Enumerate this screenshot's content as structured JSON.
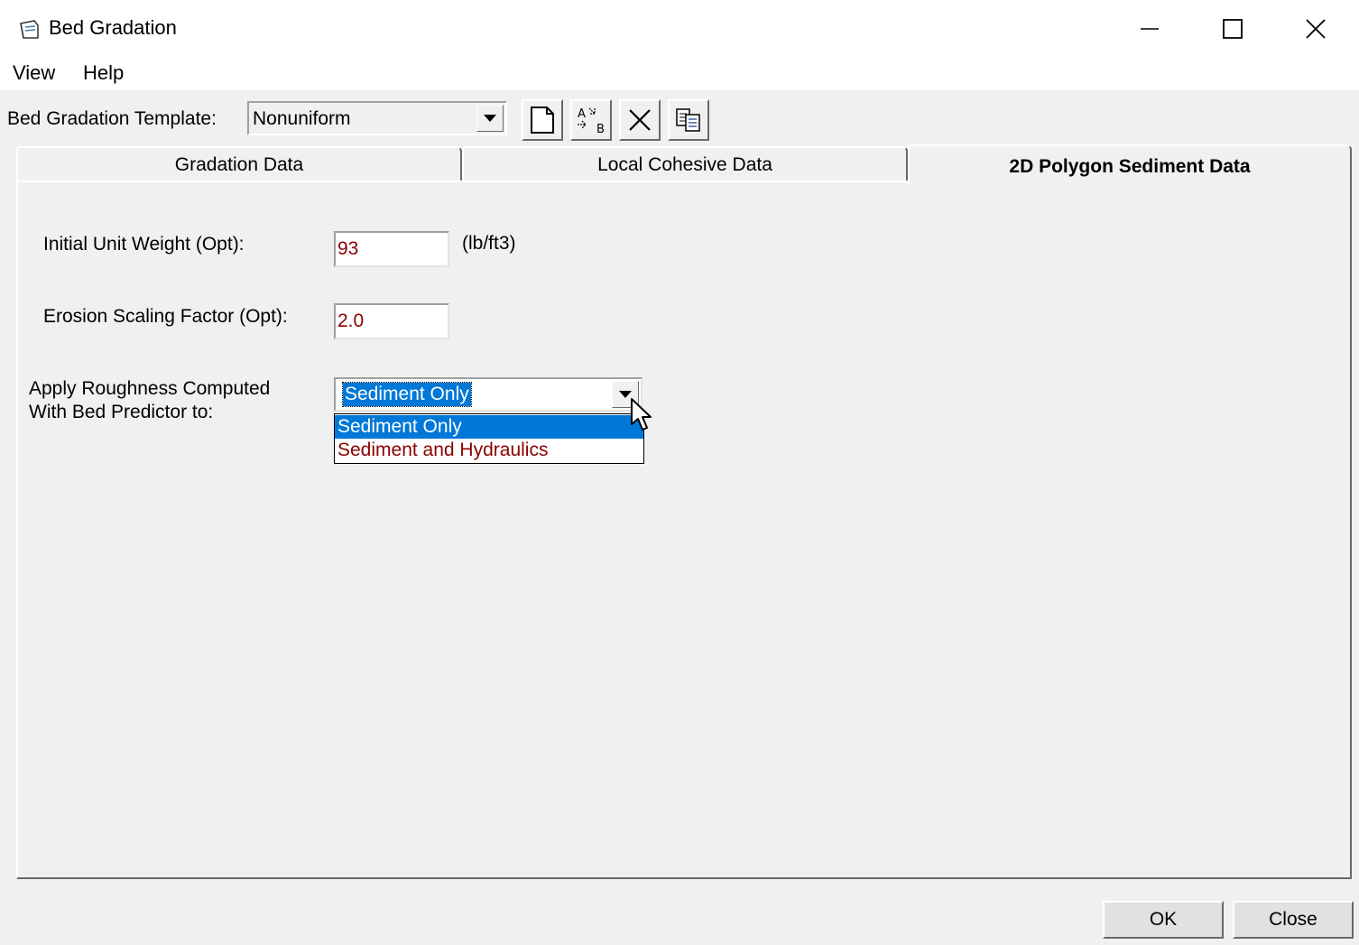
{
  "window": {
    "title": "Bed Gradation",
    "controls": [
      "minimize",
      "maximize",
      "close"
    ]
  },
  "menu": {
    "items": [
      "View",
      "Help"
    ]
  },
  "toolbar": {
    "template_label": "Bed Gradation Template:",
    "template_value": "Nonuniform",
    "buttons": [
      "new-document-icon",
      "rename-icon",
      "delete-icon",
      "copy-icon"
    ]
  },
  "tabs": [
    {
      "label": "Gradation Data",
      "active": false
    },
    {
      "label": "Local Cohesive Data",
      "active": false
    },
    {
      "label": "2D Polygon Sediment Data",
      "active": true
    }
  ],
  "form": {
    "unit_weight_label": "Initial Unit Weight (Opt):",
    "unit_weight_value": "93",
    "unit_weight_unit": "(lb/ft3)",
    "erosion_label": "Erosion Scaling Factor (Opt):",
    "erosion_value": "2.0",
    "roughness_label_line1": "Apply Roughness Computed",
    "roughness_label_line2": "With Bed Predictor to:",
    "roughness_selected": "Sediment Only",
    "roughness_options": [
      "Sediment Only",
      "Sediment and Hydraulics"
    ]
  },
  "buttons": {
    "ok": "OK",
    "close": "Close"
  },
  "colors": {
    "selection": "#0078d7",
    "value_text": "#8b0000",
    "face": "#f0f0f0"
  }
}
